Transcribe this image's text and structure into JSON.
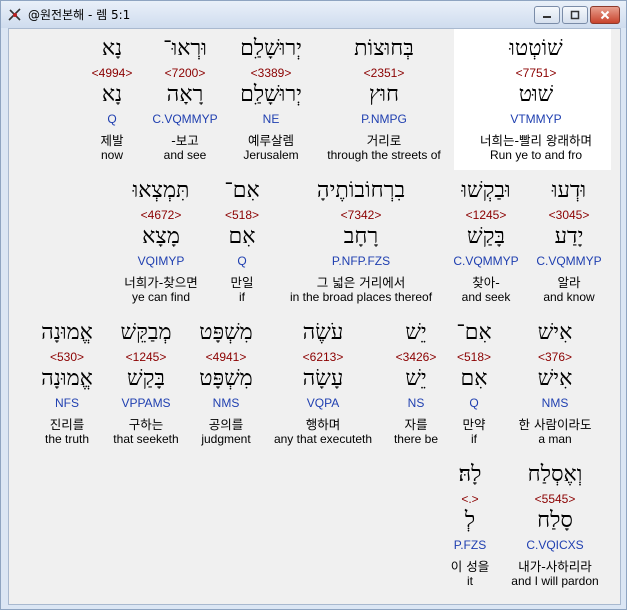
{
  "window": {
    "title": "@원전본해 - 렘 5:1",
    "buttons": {
      "minimize": "minimize-icon",
      "maximize": "maximize-icon",
      "close": "close-icon"
    }
  },
  "rows": [
    {
      "words": [
        {
          "heb": "שׁוֹטְטוּ",
          "strong": "<7751>",
          "heb2": "שׁוּט",
          "morph": "VTMMYP",
          "korean": "너희는-빨리 왕래하며",
          "english": "Run ye to and fro",
          "selected": true
        },
        {
          "heb": "בְּחוּצוֹת",
          "strong": "<2351>",
          "heb2": "חוּץ",
          "morph": "P.NMPG",
          "korean": "거리로",
          "english": "through the streets of"
        },
        {
          "heb": "יְרוּשָׁלַ͏ִם",
          "strong": "<3389>",
          "heb2": "יְרוּשָׁלַ͏ִם",
          "morph": "NE",
          "korean": "예루살렘",
          "english": "Jerusalem"
        },
        {
          "heb": "וּרְאוּ־",
          "strong": "<7200>",
          "heb2": "רָאָה",
          "morph": "C.VQMMYP",
          "korean": "-보고",
          "english": "and see"
        },
        {
          "heb": "נָא",
          "strong": "<4994>",
          "heb2": "נָא",
          "morph": "Q",
          "korean": "제발",
          "english": "now"
        }
      ]
    },
    {
      "words": [
        {
          "heb": "וּדְעוּ",
          "strong": "<3045>",
          "heb2": "יָדַע",
          "morph": "C.VQMMYP",
          "korean": "알라",
          "english": "and know"
        },
        {
          "heb": "וּבַקְשׁוּ",
          "strong": "<1245>",
          "heb2": "בָּקַשׁ",
          "morph": "C.VQMMYP",
          "korean": "찾아-",
          "english": "and seek"
        },
        {
          "heb": "בִרְחוֹבוֹתֶיהָ",
          "strong": "<7342>",
          "heb2": "רָחָב",
          "morph": "P.NFP.FZS",
          "korean": "그 넓은 거리에서",
          "english": "in the broad places thereof"
        },
        {
          "heb": "אִם־",
          "strong": "<518>",
          "heb2": "אִם",
          "morph": "Q",
          "korean": "만일",
          "english": "if"
        },
        {
          "heb": "תִּמְצְאוּ",
          "strong": "<4672>",
          "heb2": "מָצָא",
          "morph": "VQIMYP",
          "korean": "너희가-찾으면",
          "english": "ye can find"
        }
      ]
    },
    {
      "words": [
        {
          "heb": "אִישׁ",
          "strong": "<376>",
          "heb2": "אִישׁ",
          "morph": "NMS",
          "korean": "한 사람이라도",
          "english": "a man"
        },
        {
          "heb": "אִם־",
          "strong": "<518>",
          "heb2": "אִם",
          "morph": "Q",
          "korean": "만약",
          "english": "if"
        },
        {
          "heb": "יֵשׁ",
          "strong": "<3426>",
          "heb2": "יֵשׁ",
          "morph": "NS",
          "korean": "자를",
          "english": "there be"
        },
        {
          "heb": "עֹשֶׂה",
          "strong": "<6213>",
          "heb2": "עָשָׂה",
          "morph": "VQPA",
          "korean": "행하며",
          "english": "any that executeth"
        },
        {
          "heb": "מִשְׁפָּט",
          "strong": "<4941>",
          "heb2": "מִשְׁפָּט",
          "morph": "NMS",
          "korean": "공의를",
          "english": "judgment"
        },
        {
          "heb": "מְבַקֵּשׁ",
          "strong": "<1245>",
          "heb2": "בָּקַשׁ",
          "morph": "VPPAMS",
          "korean": "구하는",
          "english": "that seeketh"
        },
        {
          "heb": "אֱמוּנָה",
          "strong": "<530>",
          "heb2": "אֱמוּנָה",
          "morph": "NFS",
          "korean": "진리를",
          "english": "the truth"
        }
      ]
    },
    {
      "words": [
        {
          "heb": "וְאֶסְלַח",
          "strong": "<5545>",
          "heb2": "סָלַח",
          "morph": "C.VQICXS",
          "korean": "내가-사하리라",
          "english": "and I will pardon"
        },
        {
          "heb": "לָהּ׃",
          "strong": "<.>",
          "heb2": "לְ",
          "morph": "P.FZS",
          "korean": "이 성을",
          "english": "it"
        }
      ]
    }
  ]
}
